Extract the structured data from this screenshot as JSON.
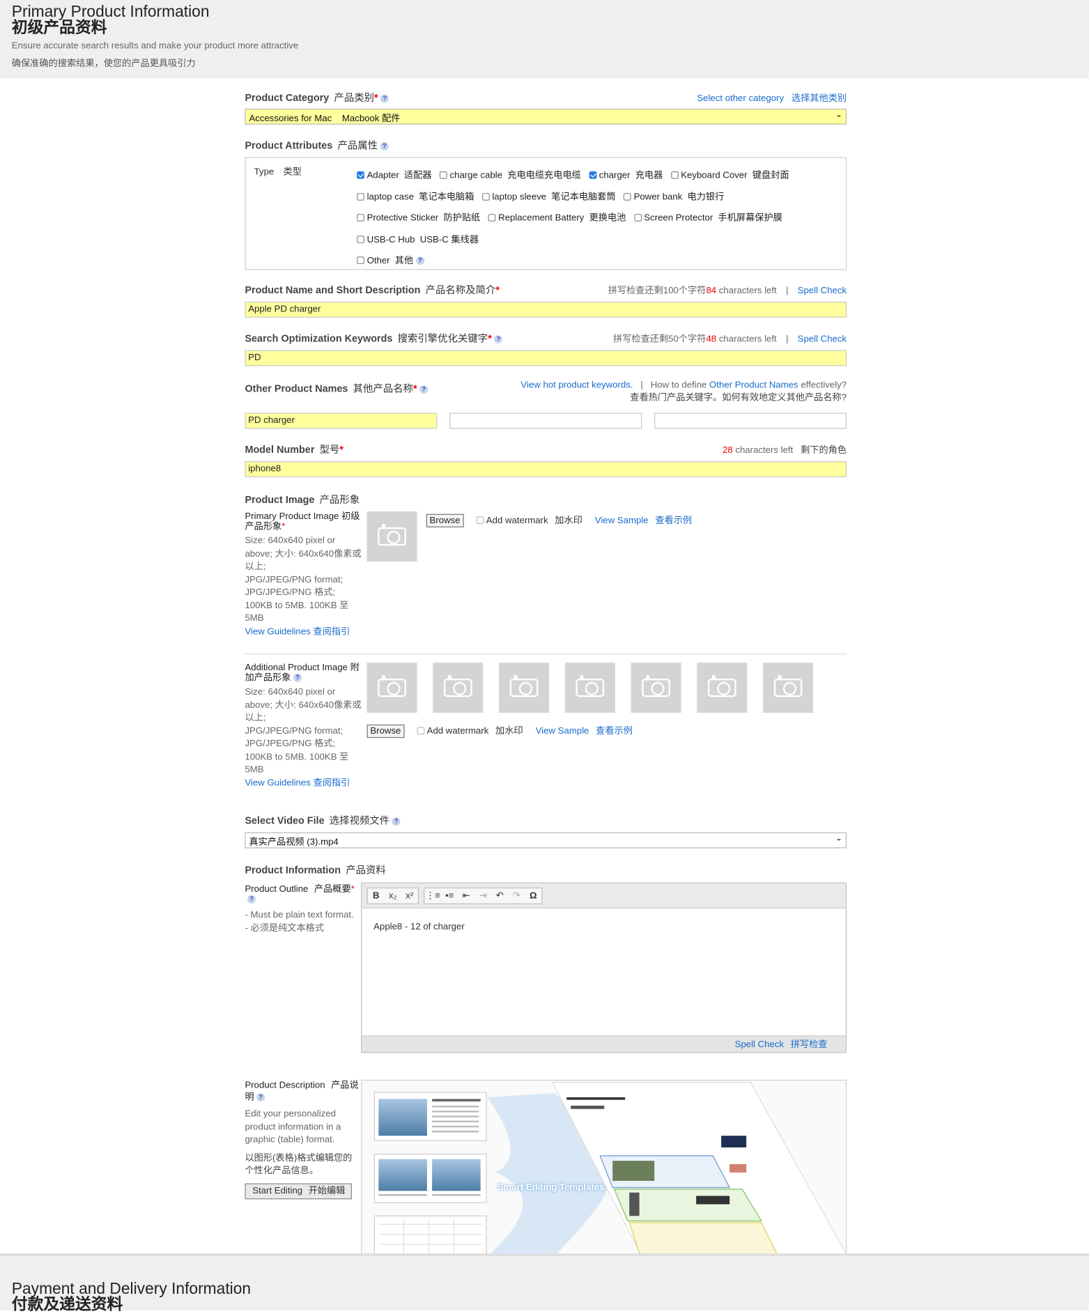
{
  "header": {
    "title_en": "Primary Product Information",
    "title_cn": "初级产品资料",
    "subtitle_en": "Ensure accurate search results and make your product more attractive",
    "subtitle_cn": "确保准确的搜索结果，使您的产品更具吸引力"
  },
  "category": {
    "label": "Product Category",
    "label_cn": "产品类别",
    "other_link": "Select other category",
    "other_link_cn": "选择其他类别",
    "value": "Accessories for Mac    Macbook 配件"
  },
  "attributes": {
    "label": "Product Attributes",
    "label_cn": "产品属性",
    "type_label": "Type",
    "type_label_cn": "类型",
    "options": [
      {
        "en": "Adapter",
        "cn": "适配器",
        "checked": true
      },
      {
        "en": "charge cable",
        "cn": "充电电缆充电电缆",
        "checked": false
      },
      {
        "en": "charger",
        "cn": "充电器",
        "checked": true
      },
      {
        "en": "Keyboard Cover",
        "cn": "键盘封面",
        "checked": false
      },
      {
        "en": "laptop case",
        "cn": "笔记本电脑箱",
        "checked": false
      },
      {
        "en": "laptop sleeve",
        "cn": "笔记本电脑套筒",
        "checked": false
      },
      {
        "en": "Power bank",
        "cn": "电力银行",
        "checked": false
      },
      {
        "en": "Protective Sticker",
        "cn": "防护贴纸",
        "checked": false
      },
      {
        "en": "Replacement Battery",
        "cn": "更换电池",
        "checked": false
      },
      {
        "en": "Screen Protector",
        "cn": "手机屏幕保护膜",
        "checked": false
      },
      {
        "en": "USB-C Hub",
        "cn": "USB-C 集线器",
        "checked": false
      },
      {
        "en": "Other",
        "cn": "其他",
        "checked": false
      }
    ]
  },
  "product_name": {
    "label": "Product Name and Short Description",
    "label_cn": "产品名称及简介",
    "counter_prefix": "拼写检查还剩100个字符",
    "counter_num": "84",
    "counter_suffix": "characters left",
    "spell_check": "Spell Check",
    "value": "Apple PD charger"
  },
  "keywords": {
    "label": "Search Optimization Keywords",
    "label_cn": "搜索引擎优化关键字",
    "counter_prefix": "拼写检查还剩50个字符",
    "counter_num": "48",
    "counter_suffix": "characters left",
    "spell_check": "Spell Check",
    "value": "PD"
  },
  "other_names": {
    "label": "Other Product Names",
    "label_cn": "其他产品名称",
    "hot_link": "View hot product keywords.",
    "howto_prefix": "How to define",
    "howto_link": "Other Product Names",
    "howto_suffix": "effectively?",
    "cn_line": "查看热门产品关键字。如何有效地定义其他产品名称?",
    "values": [
      "PD charger",
      "",
      ""
    ]
  },
  "model": {
    "label": "Model Number",
    "label_cn": "型号",
    "counter_num": "28",
    "counter_suffix": "characters left",
    "counter_cn": "剩下的角色",
    "value": "iphone8"
  },
  "image": {
    "label": "Product Image",
    "label_cn": "产品形象",
    "primary_label": "Primary Product Image",
    "primary_label_cn": "初级产品形象",
    "size_text": "Size: 640x640 pixel or above;",
    "size_text_cn": "大小: 640x640像素或以上;",
    "format_text": "JPG/JPEG/PNG format;",
    "format_text_cn": "JPG/JPEG/PNG 格式;",
    "weight_text": "100KB to 5MB.",
    "weight_text_cn": "100KB 至 5MB",
    "guidelines": "View Guidelines",
    "guidelines_cn": "查阅指引",
    "browse": "Browse",
    "watermark": "Add watermark",
    "watermark_cn": "加水印",
    "sample": "View Sample",
    "sample_cn": "查看示例",
    "additional_label": "Additional Product Image",
    "additional_label_cn": "附加产品形象"
  },
  "video": {
    "label": "Select Video File",
    "label_cn": "选择视频文件",
    "value": "真实产品视频 (3).mp4"
  },
  "info": {
    "label": "Product Information",
    "label_cn": "产品资料",
    "outline_label": "Product Outline",
    "outline_label_cn": "产品概要",
    "note1": "- Must be plain text format.",
    "note2": "- 必须是纯文本格式",
    "editor_text": "Apple8 - 12 of charger",
    "spell_check": "Spell Check",
    "spell_check_cn": "拼写检查",
    "toolbar": [
      "B",
      "x₂",
      "x²",
      "⋮≡",
      "•≡",
      "⇤",
      "⇥",
      "↶",
      "↷",
      "Ω"
    ]
  },
  "description": {
    "label": "Product Description",
    "label_cn": "产品说明",
    "text1": "Edit your personalized product information in a graphic (table) format.",
    "text2": "以图形(表格)格式编辑您的个性化产品信息。",
    "button": "Start Editing",
    "button_cn": "开始编辑",
    "banner": "Smart Editing Templates"
  },
  "footer": {
    "title_en": "Payment and Delivery Information",
    "title_cn": "付款及递送资料"
  }
}
